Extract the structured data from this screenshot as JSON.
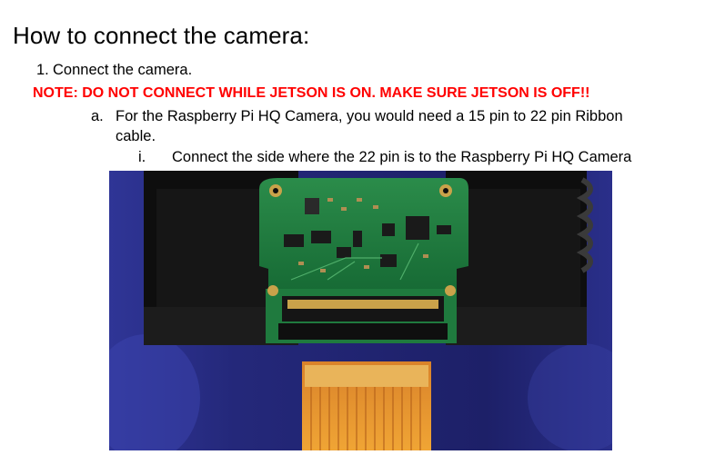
{
  "heading": "How to connect the camera:",
  "steps": [
    {
      "marker": "1.",
      "text": "Connect the camera.",
      "warning": "NOTE: DO NOT CONNECT WHILE JETSON IS ON. MAKE SURE JETSON IS OFF!!",
      "substeps": [
        {
          "marker": "a.",
          "text_line1": "For the Raspberry Pi HQ Camera, you would need a 15 pin to 22 pin Ribbon",
          "text_line2": "cable.",
          "substeps": [
            {
              "marker": "i.",
              "text": "Connect the side where the 22 pin is to the Raspberry Pi HQ Camera"
            }
          ]
        }
      ]
    }
  ],
  "colors": {
    "warning": "#ff0000",
    "pcb": "#1f7a3e",
    "ribbon": "#e89a2c",
    "connector": "#151515",
    "gold": "#c9a24a",
    "mount": "#0c0c0c",
    "background": "#2b2f8f"
  }
}
